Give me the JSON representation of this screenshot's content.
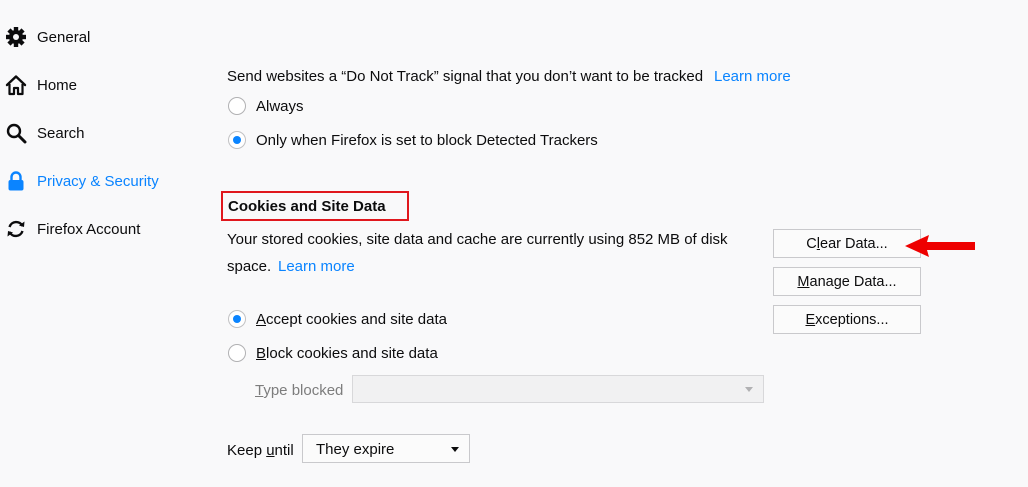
{
  "sidebar": {
    "items": [
      {
        "label": "General",
        "icon": "gear-icon"
      },
      {
        "label": "Home",
        "icon": "home-icon"
      },
      {
        "label": "Search",
        "icon": "search-icon"
      },
      {
        "label": "Privacy & Security",
        "icon": "lock-icon",
        "selected": true
      },
      {
        "label": "Firefox Account",
        "icon": "sync-icon"
      }
    ]
  },
  "dnt": {
    "text": "Send websites a “Do Not Track” signal that you don’t want to be tracked",
    "learn_more": "Learn more",
    "options": [
      {
        "label": "Always",
        "checked": false
      },
      {
        "label": "Only when Firefox is set to block Detected Trackers",
        "checked": true
      }
    ]
  },
  "cookies": {
    "heading": "Cookies and Site Data",
    "desc_line1": "Your stored cookies, site data and cache are currently using 852 MB of disk",
    "desc_line2": "space.",
    "learn_more": "Learn more",
    "buttons": {
      "clear": {
        "pre": "C",
        "ul": "l",
        "post": "ear Data..."
      },
      "manage": {
        "pre": "",
        "ul": "M",
        "post": "anage Data..."
      },
      "exceptions": {
        "pre": "",
        "ul": "E",
        "post": "xceptions..."
      }
    },
    "accept": {
      "pre": "",
      "ul": "A",
      "post": "ccept cookies and site data",
      "checked": true
    },
    "block": {
      "pre": "",
      "ul": "B",
      "post": "lock cookies and site data",
      "checked": false
    },
    "type_blocked": {
      "pre": "",
      "ul": "T",
      "post": "ype blocked",
      "value": ""
    },
    "keep_until": {
      "pre": "Keep ",
      "ul": "u",
      "post": "ntil",
      "value": "They expire"
    }
  },
  "colors": {
    "accent": "#0a84ff",
    "highlight": "#e0171d"
  }
}
